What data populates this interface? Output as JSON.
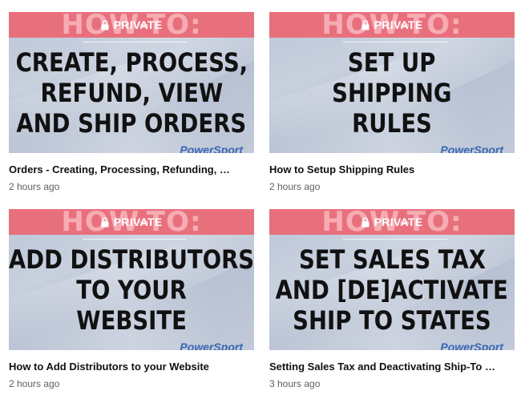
{
  "videos": [
    {
      "howto": "HOW-TO:",
      "privacy": "PRIVATE",
      "headline": [
        "CREATE, PROCESS,",
        "REFUND, VIEW",
        "AND SHIP ORDERS"
      ],
      "title": "Orders - Creating, Processing, Refunding, …",
      "time": "2 hours ago",
      "brand": "PowerSport"
    },
    {
      "howto": "HOW-TO:",
      "privacy": "PRIVATE",
      "headline": [
        "SET UP",
        "SHIPPING",
        "RULES"
      ],
      "title": "How to Setup Shipping Rules",
      "time": "2 hours ago",
      "brand": "PowerSport"
    },
    {
      "howto": "HOW-TO:",
      "privacy": "PRIVATE",
      "headline": [
        "ADD DISTRIBUTORS",
        "TO YOUR",
        "WEBSITE"
      ],
      "title": "How to Add Distributors to your Website",
      "time": "2 hours ago",
      "brand": "PowerSport"
    },
    {
      "howto": "HOW-TO:",
      "privacy": "PRIVATE",
      "headline": [
        "SET SALES TAX",
        "AND [DE]ACTIVATE",
        "SHIP TO STATES"
      ],
      "title": "Setting Sales Tax and Deactivating Ship-To …",
      "time": "3 hours ago",
      "brand": "PowerSport"
    }
  ],
  "colors": {
    "banner": "#e8707c",
    "headline": "#111111",
    "meta": "#606060"
  }
}
